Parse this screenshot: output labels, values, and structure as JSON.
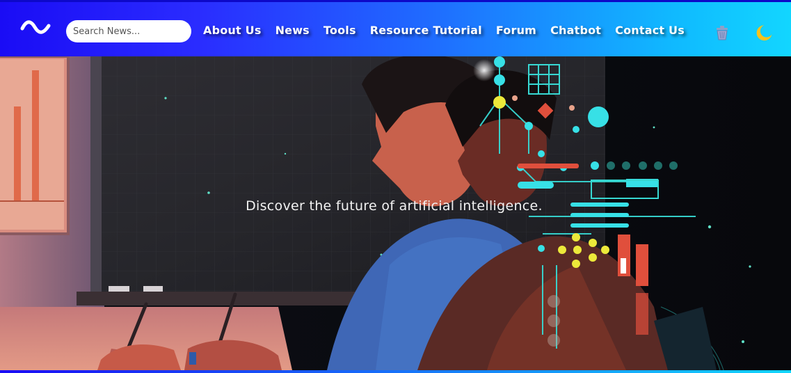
{
  "header": {
    "logo_icon": "wave-logo-icon",
    "search": {
      "placeholder": "Search News...",
      "value": ""
    },
    "nav": [
      {
        "label": "About Us"
      },
      {
        "label": "News"
      },
      {
        "label": "Tools"
      },
      {
        "label": "Resource Tutorial"
      },
      {
        "label": "Forum"
      },
      {
        "label": "Chatbot"
      },
      {
        "label": "Contact Us"
      }
    ],
    "icons": {
      "trash": "trash-icon",
      "theme": "moon-icon"
    },
    "colors": {
      "gradient_start": "#1a0cf5",
      "gradient_end": "#12d6ff"
    }
  },
  "hero": {
    "tagline": "Discover the future of artificial intelligence.",
    "image": "ai-illustration"
  }
}
